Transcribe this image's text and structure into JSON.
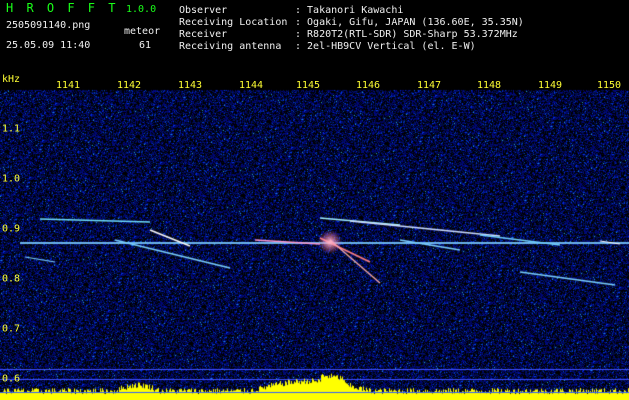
{
  "header": {
    "app_name": "H R O F F T",
    "version": "1.0.0",
    "filename": "2505091140.png",
    "meteor_label": "meteor",
    "datetime": "25.05.09 11:40",
    "meteor_count": "61",
    "info": [
      {
        "key": "Observer",
        "value": ": Takanori Kawachi"
      },
      {
        "key": "Receiving Location",
        "value": ": Ogaki, Gifu, JAPAN (136.60E, 35.35N)"
      },
      {
        "key": "Receiver",
        "value": ": R820T2(RTL-SDR) SDR-Sharp 53.372MHz"
      },
      {
        "key": "Receiving antenna",
        "value": ": 2el-HB9CV Vertical (el. E-W)"
      }
    ]
  },
  "axes": {
    "y_unit": "kHz",
    "time_ticks": [
      "1141",
      "1142",
      "1143",
      "1144",
      "1145",
      "1146",
      "1147",
      "1148",
      "1149",
      "1150"
    ],
    "freq_ticks": [
      "1.1",
      "1.0",
      "0.9",
      "0.8",
      "0.7",
      "0.6"
    ]
  },
  "colors": {
    "background": "#000000",
    "noise": "#0a0f8c",
    "carrier": "#6fd0ff",
    "trail": "#ffffff",
    "activity_bar": "#ffff00",
    "text_green": "#19ff19",
    "text_yellow": "#ffff33"
  }
}
